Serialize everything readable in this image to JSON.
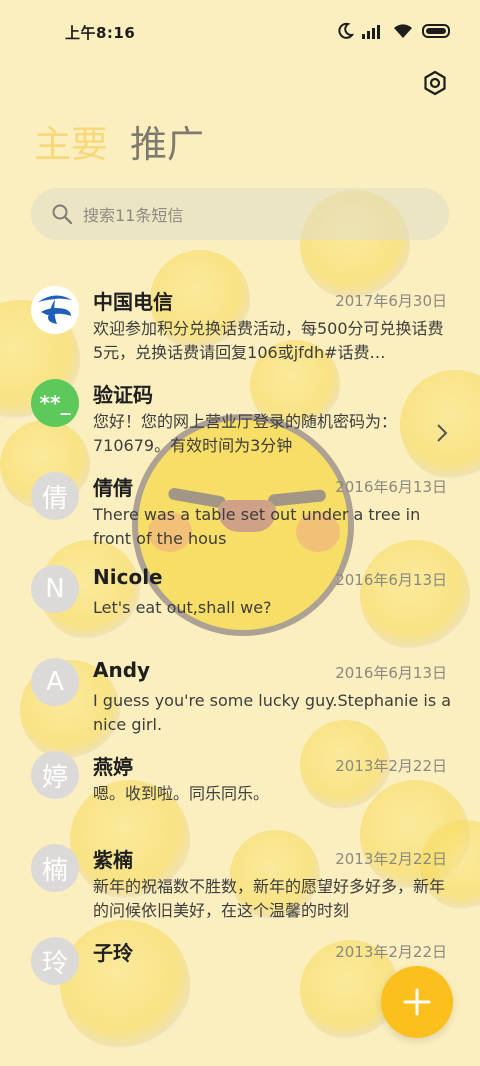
{
  "status": {
    "time": "上午8:16"
  },
  "tabs": [
    {
      "label": "主要",
      "active": true
    },
    {
      "label": "推广",
      "active": false
    }
  ],
  "search": {
    "placeholder": "搜索11条短信"
  },
  "messages": [
    {
      "sender": "中国电信",
      "date": "2017年6月30日",
      "preview": "欢迎参加积分兑换话费活动，每500分可兑换话费5元，兑换话费请回复106或jfdh#话费…",
      "avatar": "telecom-logo"
    },
    {
      "sender": "验证码",
      "date": "",
      "preview": "您好！您的网上营业厅登录的随机密码为：710679。有效时间为3分钟",
      "avatar_text": "**_"
    },
    {
      "sender": "倩倩",
      "date": "2016年6月13日",
      "preview": "There was a table set out under a tree in front of the hous",
      "avatar_text": "倩"
    },
    {
      "sender": "Nicole",
      "date": "2016年6月13日",
      "preview": "Let's eat out,shall we?",
      "avatar_text": "N"
    },
    {
      "sender": "Andy",
      "date": "2016年6月13日",
      "preview": "I guess you're some lucky guy.Stephanie is a nice girl.",
      "avatar_text": "A"
    },
    {
      "sender": "燕婷",
      "date": "2013年2月22日",
      "preview": "嗯。收到啦。同乐同乐。",
      "avatar_text": "婷"
    },
    {
      "sender": "紫楠",
      "date": "2013年2月22日",
      "preview": "新年的祝福数不胜数，新年的愿望好多好多，新年的问候依旧美好，在这个温馨的时刻",
      "avatar_text": "楠"
    },
    {
      "sender": "子玲",
      "date": "2013年2月22日",
      "preview": "",
      "avatar_text": "玲"
    }
  ],
  "colors": {
    "accent": "#fbbf1e",
    "active_tab": "#f8d87a",
    "verify_avatar": "#5cc95a",
    "telecom": "#1f5fb8"
  }
}
